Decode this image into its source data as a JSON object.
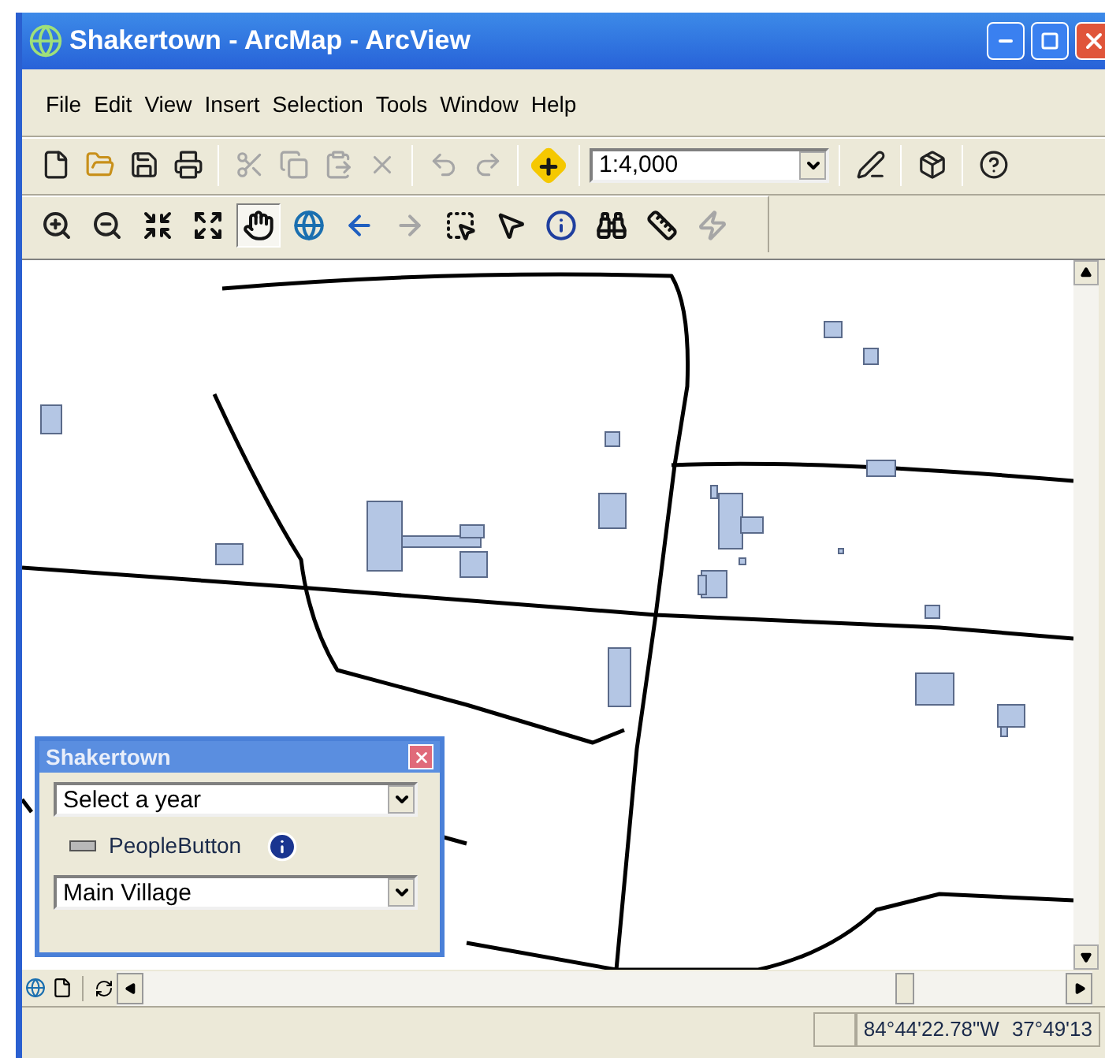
{
  "window": {
    "title": "Shakertown - ArcMap - ArcView"
  },
  "menu": [
    "File",
    "Edit",
    "View",
    "Insert",
    "Selection",
    "Tools",
    "Window",
    "Help"
  ],
  "standard_toolbar": {
    "left_groups": [
      [
        {
          "kind": "new",
          "disabled": false
        },
        {
          "kind": "open",
          "disabled": false
        },
        {
          "kind": "save",
          "disabled": false
        },
        {
          "kind": "print",
          "disabled": false
        }
      ],
      [
        {
          "kind": "cut",
          "disabled": true
        },
        {
          "kind": "copy",
          "disabled": true
        },
        {
          "kind": "paste",
          "disabled": true
        },
        {
          "kind": "delete",
          "disabled": true
        }
      ],
      [
        {
          "kind": "undo",
          "disabled": true
        },
        {
          "kind": "redo",
          "disabled": true
        }
      ],
      [
        {
          "kind": "add",
          "disabled": false
        }
      ]
    ],
    "right_groups": [
      [
        {
          "kind": "editor",
          "disabled": false
        }
      ],
      [
        {
          "kind": "toolbox",
          "disabled": false
        }
      ],
      [
        {
          "kind": "help",
          "disabled": false
        }
      ]
    ]
  },
  "scale": {
    "value": "1:4,000"
  },
  "tools_toolbar": [
    {
      "kind": "zoom-in",
      "selected": false,
      "disabled": false
    },
    {
      "kind": "zoom-out",
      "selected": false,
      "disabled": false
    },
    {
      "kind": "fixed-in",
      "selected": false,
      "disabled": false
    },
    {
      "kind": "fixed-out",
      "selected": false,
      "disabled": false
    },
    {
      "kind": "pan",
      "selected": true,
      "disabled": false
    },
    {
      "kind": "globe",
      "selected": false,
      "disabled": false
    },
    {
      "kind": "back",
      "selected": false,
      "disabled": false
    },
    {
      "kind": "forward",
      "selected": false,
      "disabled": true
    },
    {
      "kind": "select-elements",
      "selected": false,
      "disabled": false
    },
    {
      "kind": "pointer",
      "selected": false,
      "disabled": false
    },
    {
      "kind": "identify",
      "selected": false,
      "disabled": false
    },
    {
      "kind": "find",
      "selected": false,
      "disabled": false
    },
    {
      "kind": "measure",
      "selected": false,
      "disabled": false
    },
    {
      "kind": "lightning",
      "selected": false,
      "disabled": true
    }
  ],
  "dialog": {
    "title": "Shakertown",
    "year_select": {
      "value": "Select a year"
    },
    "people_button": {
      "label": "PeopleButton"
    },
    "area_select": {
      "value": "Main Village"
    }
  },
  "status_bar": {
    "longitude": "84°44'22.78\"W",
    "latitude": "37°49'13"
  }
}
